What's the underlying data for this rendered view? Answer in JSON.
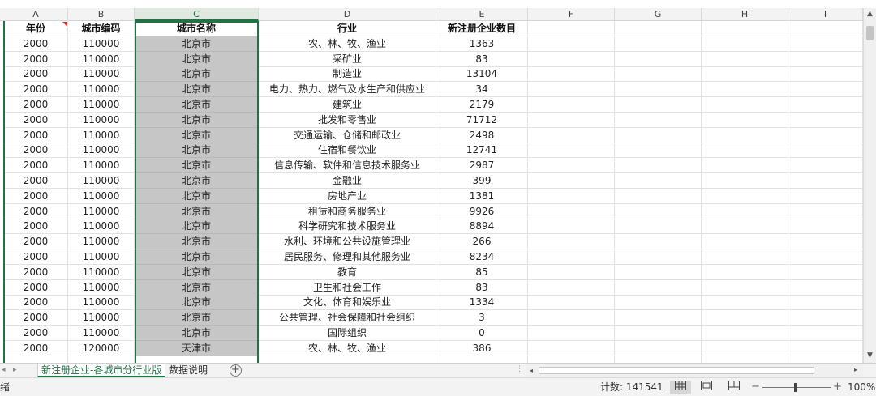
{
  "columns": [
    "A",
    "B",
    "C",
    "D",
    "E",
    "F",
    "G",
    "H",
    "I"
  ],
  "headers": [
    "年份",
    "城市编码",
    "城市名称",
    "行业",
    "新注册企业数目"
  ],
  "rows": [
    [
      "2000",
      "110000",
      "北京市",
      "农、林、牧、渔业",
      "1363"
    ],
    [
      "2000",
      "110000",
      "北京市",
      "采矿业",
      "83"
    ],
    [
      "2000",
      "110000",
      "北京市",
      "制造业",
      "13104"
    ],
    [
      "2000",
      "110000",
      "北京市",
      "电力、热力、燃气及水生产和供应业",
      "34"
    ],
    [
      "2000",
      "110000",
      "北京市",
      "建筑业",
      "2179"
    ],
    [
      "2000",
      "110000",
      "北京市",
      "批发和零售业",
      "71712"
    ],
    [
      "2000",
      "110000",
      "北京市",
      "交通运输、仓储和邮政业",
      "2498"
    ],
    [
      "2000",
      "110000",
      "北京市",
      "住宿和餐饮业",
      "12741"
    ],
    [
      "2000",
      "110000",
      "北京市",
      "信息传输、软件和信息技术服务业",
      "2987"
    ],
    [
      "2000",
      "110000",
      "北京市",
      "金融业",
      "399"
    ],
    [
      "2000",
      "110000",
      "北京市",
      "房地产业",
      "1381"
    ],
    [
      "2000",
      "110000",
      "北京市",
      "租赁和商务服务业",
      "9926"
    ],
    [
      "2000",
      "110000",
      "北京市",
      "科学研究和技术服务业",
      "8894"
    ],
    [
      "2000",
      "110000",
      "北京市",
      "水利、环境和公共设施管理业",
      "266"
    ],
    [
      "2000",
      "110000",
      "北京市",
      "居民服务、修理和其他服务业",
      "8234"
    ],
    [
      "2000",
      "110000",
      "北京市",
      "教育",
      "85"
    ],
    [
      "2000",
      "110000",
      "北京市",
      "卫生和社会工作",
      "83"
    ],
    [
      "2000",
      "110000",
      "北京市",
      "文化、体育和娱乐业",
      "1334"
    ],
    [
      "2000",
      "110000",
      "北京市",
      "公共管理、社会保障和社会组织",
      "3"
    ],
    [
      "2000",
      "110000",
      "北京市",
      "国际组织",
      "0"
    ],
    [
      "2000",
      "120000",
      "天津市",
      "农、林、牧、渔业",
      "386"
    ]
  ],
  "sheet_tabs": [
    "新注册企业-各城市分行业版",
    "数据说明"
  ],
  "active_sheet": "新注册企业-各城市分行业版",
  "status": {
    "mode": "绪",
    "count_label": "计数: 141541",
    "zoom": "100%"
  },
  "colors": {
    "accent": "#217346",
    "selected_fill": "#c6c6c6"
  }
}
